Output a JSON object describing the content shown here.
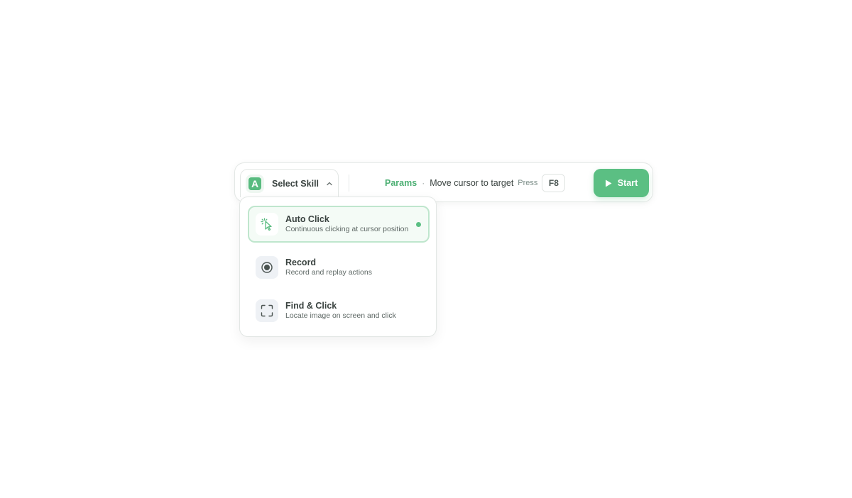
{
  "toolbar": {
    "skill_select_label": "Select Skill",
    "logo_letter": "A",
    "params_label": "Params",
    "separator": "·",
    "params_hint": "Move cursor to target",
    "press_label": "Press",
    "hotkey": "F8",
    "start_label": "Start"
  },
  "dropdown": {
    "items": [
      {
        "title": "Auto Click",
        "description": "Continuous clicking at cursor position",
        "icon": "cursor-click-icon",
        "selected": true
      },
      {
        "title": "Record",
        "description": "Record and replay actions",
        "icon": "record-icon",
        "selected": false
      },
      {
        "title": "Find & Click",
        "description": "Locate image on screen and click",
        "icon": "scan-frame-icon",
        "selected": false
      }
    ]
  },
  "colors": {
    "accent": "#5bbf83",
    "accent_text": "#4caf73",
    "active_border": "#bfe6cd",
    "active_bg": "#f4fbf6"
  }
}
